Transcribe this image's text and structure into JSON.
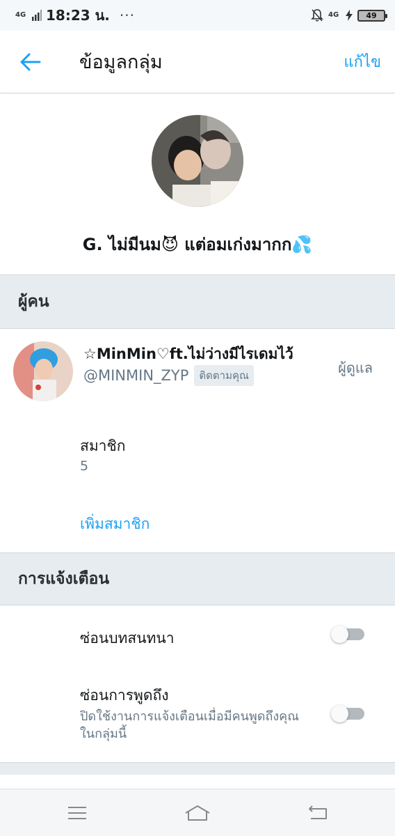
{
  "status_bar": {
    "network_left": "4G",
    "time": "18:23 น.",
    "dots": "···",
    "network_right": "4G",
    "battery": "49"
  },
  "app_bar": {
    "title": "ข้อมูลกลุ่ม",
    "edit_label": "แก้ไข",
    "back_icon": "arrow-left-icon",
    "accent_color": "#1da1f2"
  },
  "group": {
    "name": "G. ไม่มีนม😈 แต่อมเก่งมากก💦"
  },
  "people_section": {
    "heading": "ผู้คน",
    "member": {
      "name": "☆MinMin♡ft.ไม่ว่างมีไรเดมไว้",
      "handle": "@MINMIN_ZYP",
      "follows_badge": "ติดตามคุณ",
      "role": "ผู้ดูแล"
    },
    "members_label": "สมาชิก",
    "members_count": "5",
    "add_member_label": "เพิ่มสมาชิก"
  },
  "notifications_section": {
    "heading": "การแจ้งเตือน",
    "items": [
      {
        "title": "ซ่อนบทสนทนา",
        "subtitle": "",
        "enabled": false
      },
      {
        "title": "ซ่อนการพูดถึง",
        "subtitle": "ปิดใช้งานการแจ้งเตือนเมื่อมีคนพูดถึงคุณในกลุ่มนี้",
        "enabled": false
      }
    ]
  },
  "nav_bar": {
    "icons": [
      "menu-icon",
      "home-icon",
      "back-icon"
    ]
  }
}
